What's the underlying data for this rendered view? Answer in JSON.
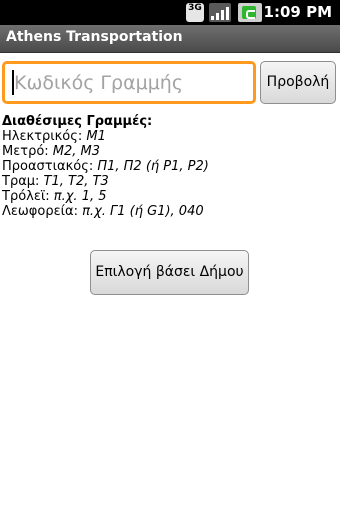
{
  "statusbar": {
    "network": "3G",
    "time": "1:09 PM"
  },
  "app": {
    "title": "Athens Transportation"
  },
  "search": {
    "placeholder": "Κωδικός Γραμμής",
    "value": "",
    "button_label": "Προβολή"
  },
  "lines_info": {
    "title": "Διαθέσιμες Γραμμές:",
    "rows": [
      {
        "label": "Ηλεκτρικός: ",
        "value": "M1"
      },
      {
        "label": "Μετρό: ",
        "value": "M2, M3"
      },
      {
        "label": "Προαστιακός: ",
        "value": "Π1, Π2 (ή P1, P2)"
      },
      {
        "label": "Τραμ: ",
        "value": "T1, T2, T3"
      },
      {
        "label": "Τρόλεϊ: ",
        "value": "π.χ. 1, 5"
      },
      {
        "label": "Λεωφορεία: ",
        "value": "π.χ. Γ1 (ή G1), 040"
      }
    ]
  },
  "municipality_button": {
    "label": "Επιλογή βάσει Δήμου"
  },
  "icons": [
    "network-3g-icon",
    "signal-strength-icon",
    "battery-charging-icon"
  ],
  "colors": {
    "focus_border": "#ff9a1f",
    "titlebar": "#5a5a5a",
    "statusbar": "#000000"
  }
}
